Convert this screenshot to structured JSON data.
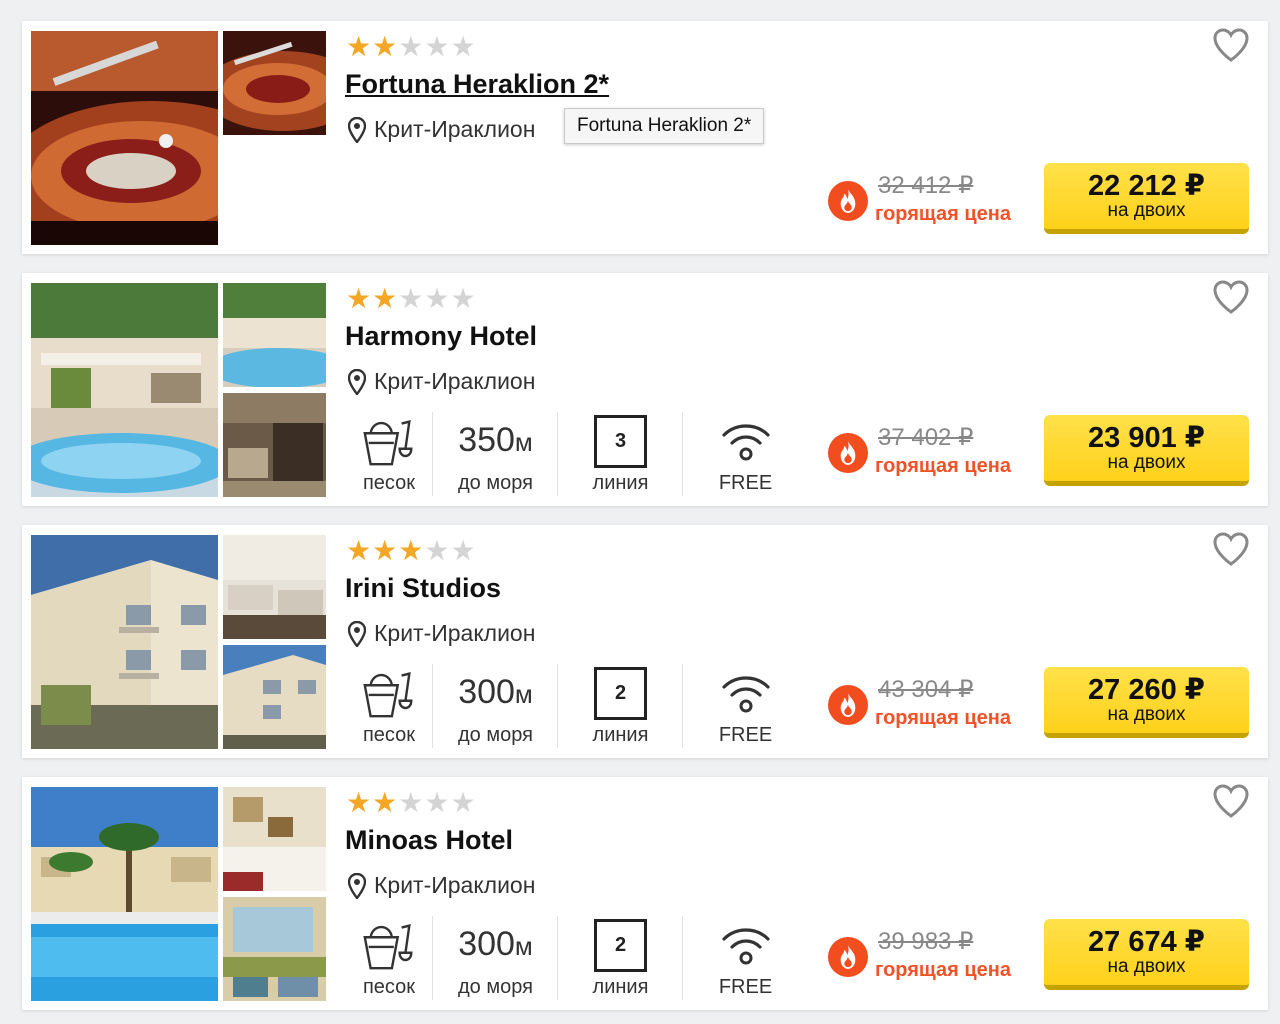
{
  "accent_colors": {
    "star_on": "#f5a623",
    "star_off": "#d4d4d4",
    "hot": "#f0522a",
    "price_button": "#ffd11a"
  },
  "hotels": [
    {
      "stars": 2,
      "name": "Fortuna Heraklion 2*",
      "location": "Крит-Ираклион",
      "tooltip": "Fortuna Heraklion 2*",
      "old_price": "32 412 ₽",
      "hot_label": "горящая цена",
      "price": "22 212 ₽",
      "price_note": "на двоих",
      "photos": [
        "casino-roulette-photo",
        "roulette-wheel-photo"
      ]
    },
    {
      "stars": 2,
      "name": "Harmony Hotel",
      "location": "Крит-Ираклион",
      "features": {
        "beach_type": "песок",
        "distance_value": "350",
        "distance_unit": "м",
        "distance_label": "до моря",
        "line_number": "3",
        "line_label": "линия",
        "wifi_label": "FREE"
      },
      "old_price": "37 402 ₽",
      "hot_label": "горящая цена",
      "price": "23 901 ₽",
      "price_note": "на двоих",
      "photos": [
        "pool-terrace-photo",
        "pool-photo",
        "patio-photo"
      ]
    },
    {
      "stars": 3,
      "name": "Irini Studios",
      "location": "Крит-Ираклион",
      "features": {
        "beach_type": "песок",
        "distance_value": "300",
        "distance_unit": "м",
        "distance_label": "до моря",
        "line_number": "2",
        "line_label": "линия",
        "wifi_label": "FREE"
      },
      "old_price": "43 304 ₽",
      "hot_label": "горящая цена",
      "price": "27 260 ₽",
      "price_note": "на двоих",
      "photos": [
        "building-facade-photo",
        "bedroom-photo",
        "building-side-photo"
      ]
    },
    {
      "stars": 2,
      "name": "Minoas Hotel",
      "location": "Крит-Ираклион",
      "features": {
        "beach_type": "песок",
        "distance_value": "300",
        "distance_unit": "м",
        "distance_label": "до моря",
        "line_number": "2",
        "line_label": "линия",
        "wifi_label": "FREE"
      },
      "old_price": "39 983 ₽",
      "hot_label": "горящая цена",
      "price": "27 674 ₽",
      "price_note": "на двоих",
      "photos": [
        "pool-palms-photo",
        "hotel-room-photo",
        "lounge-photo"
      ]
    }
  ]
}
